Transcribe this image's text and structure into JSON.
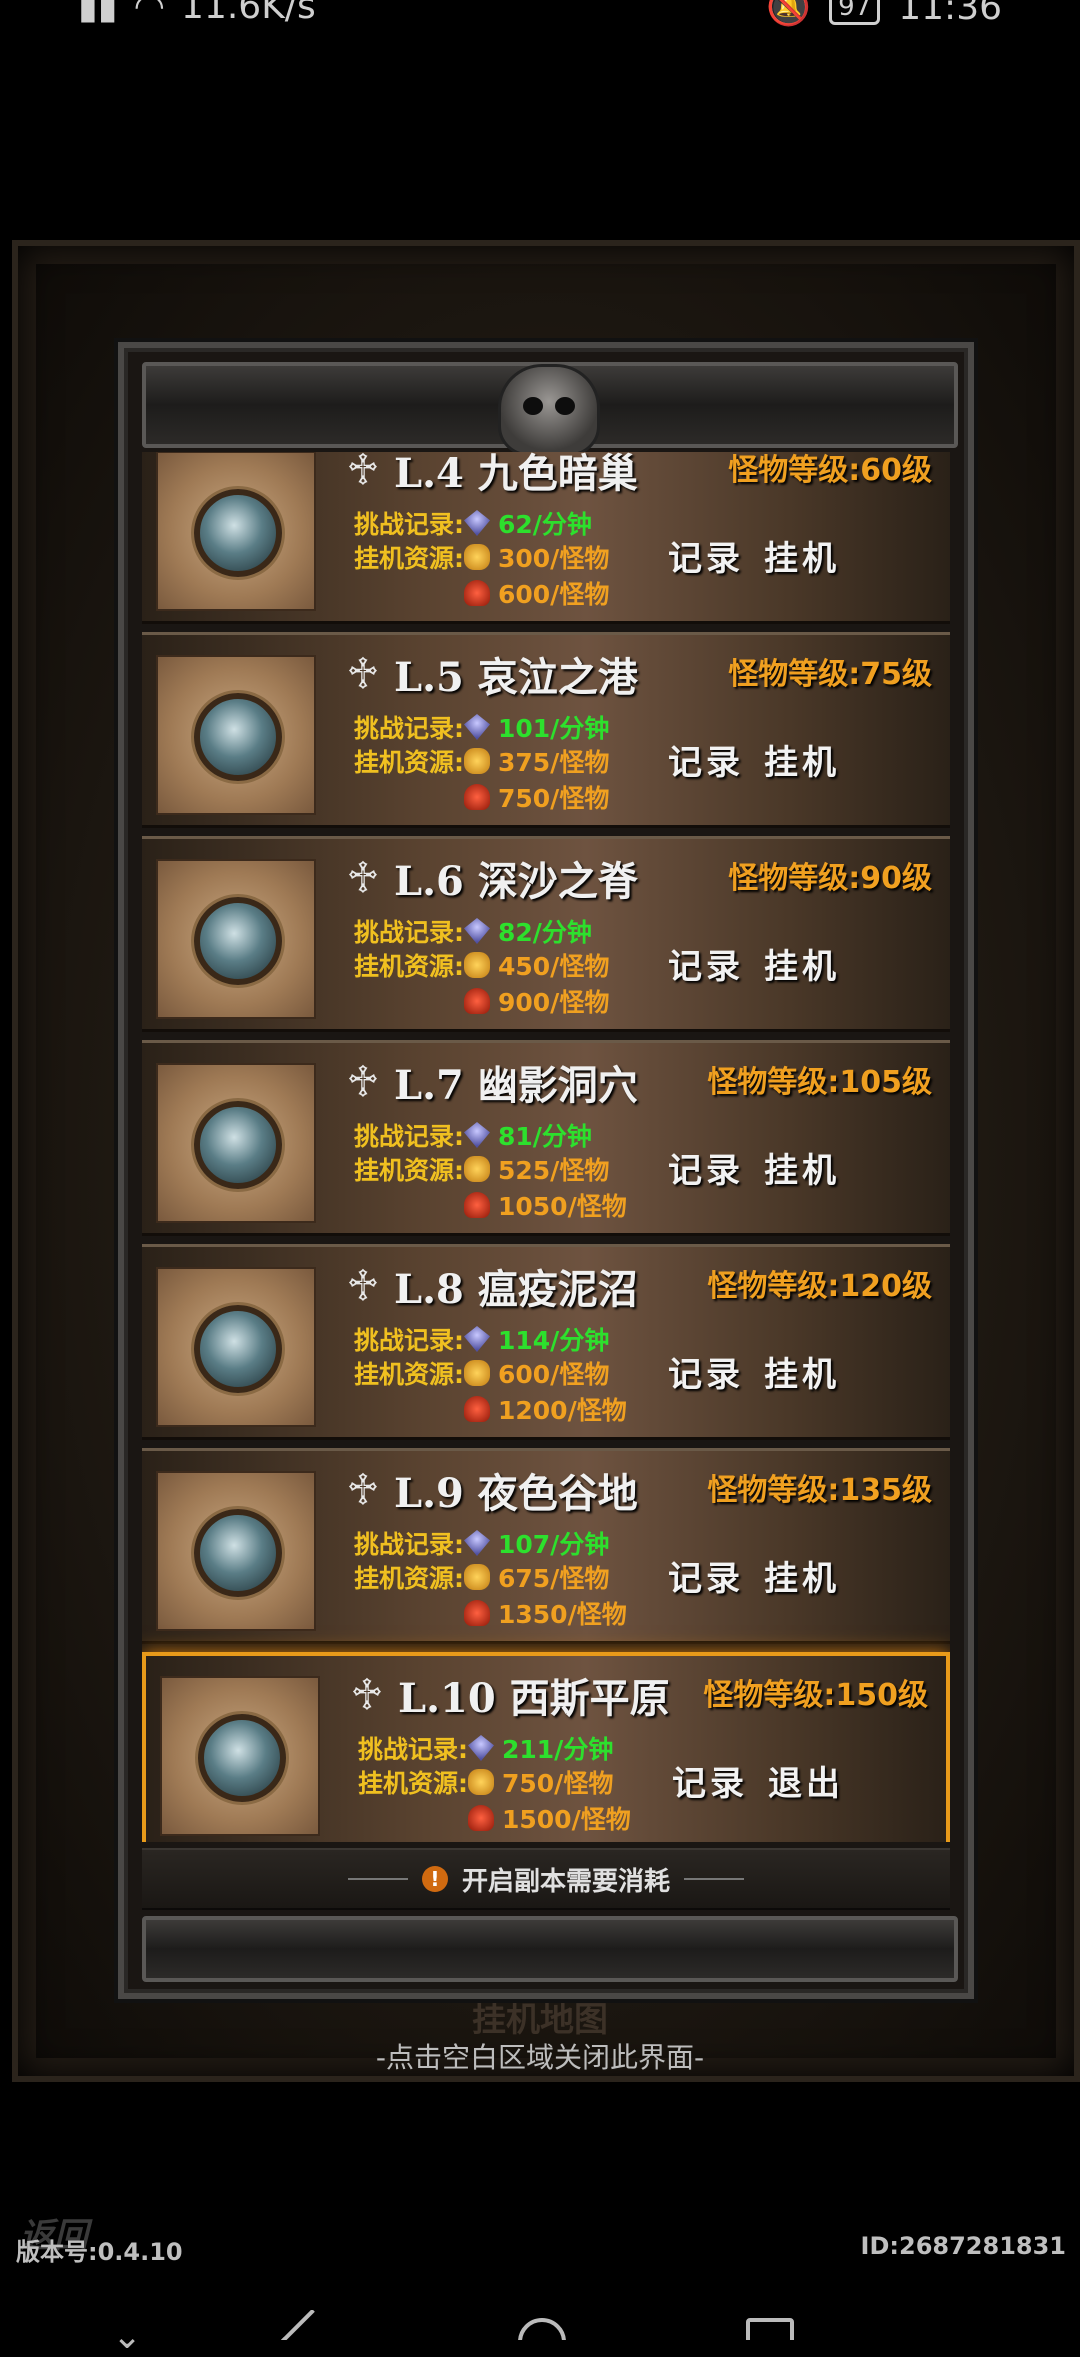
{
  "status_bar": {
    "network_speed": "11.6K/s",
    "battery": "97",
    "time": "11:36"
  },
  "dialog": {
    "background_title": "挂机地图",
    "cards": [
      {
        "level": "L.4 九色暗巢",
        "monster_level": "怪物等级:60级",
        "challenge": "62/分钟",
        "gold": "300/怪物",
        "resource": "600/怪物",
        "btn_record": "记录",
        "btn_action": "挂机",
        "selected": false
      },
      {
        "level": "L.5 哀泣之港",
        "monster_level": "怪物等级:75级",
        "challenge": "101/分钟",
        "gold": "375/怪物",
        "resource": "750/怪物",
        "btn_record": "记录",
        "btn_action": "挂机",
        "selected": false
      },
      {
        "level": "L.6 深沙之脊",
        "monster_level": "怪物等级:90级",
        "challenge": "82/分钟",
        "gold": "450/怪物",
        "resource": "900/怪物",
        "btn_record": "记录",
        "btn_action": "挂机",
        "selected": false
      },
      {
        "level": "L.7 幽影洞穴",
        "monster_level": "怪物等级:105级",
        "challenge": "81/分钟",
        "gold": "525/怪物",
        "resource": "1050/怪物",
        "btn_record": "记录",
        "btn_action": "挂机",
        "selected": false
      },
      {
        "level": "L.8 瘟疫泥沼",
        "monster_level": "怪物等级:120级",
        "challenge": "114/分钟",
        "gold": "600/怪物",
        "resource": "1200/怪物",
        "btn_record": "记录",
        "btn_action": "挂机",
        "selected": false
      },
      {
        "level": "L.9 夜色谷地",
        "monster_level": "怪物等级:135级",
        "challenge": "107/分钟",
        "gold": "675/怪物",
        "resource": "1350/怪物",
        "btn_record": "记录",
        "btn_action": "挂机",
        "selected": false
      },
      {
        "level": "L.10 西斯平原",
        "monster_level": "怪物等级:150级",
        "challenge": "211/分钟",
        "gold": "750/怪物",
        "resource": "1500/怪物",
        "btn_record": "记录",
        "btn_action": "退出",
        "selected": true
      }
    ],
    "labels": {
      "challenge": "挑战记录:",
      "idle_resource": "挂机资源:"
    },
    "cost_text": "开启副本需要消耗",
    "close_hint": "-点击空白区域关闭此界面-"
  },
  "footer": {
    "back": "返回",
    "version": "版本号:0.4.10",
    "user_id": "ID:2687281831"
  }
}
